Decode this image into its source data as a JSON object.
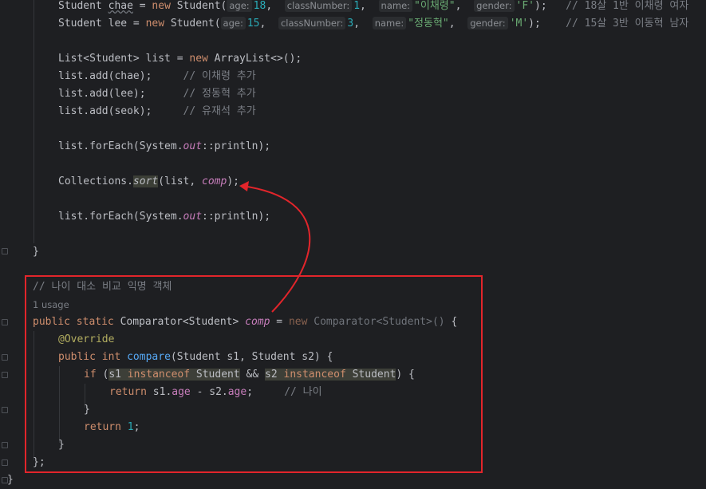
{
  "editor": {
    "language": "Java",
    "lines": {
      "l1": {
        "indent": "    ",
        "type": "Student",
        "var": "chae",
        "new_kw": "new",
        "ctor": "Student(",
        "hint_age": "age:",
        "age": "18",
        "hint_class": "classNumber:",
        "cls": "1",
        "hint_name": "name:",
        "name": "\"이채령\"",
        "hint_gender": "gender:",
        "gender": "'F'",
        "end": ");",
        "comment": "// 18살 1반 이채령 여자"
      },
      "l2": {
        "type": "Student",
        "var": "lee",
        "new_kw": "new",
        "ctor": "Student(",
        "hint_age": "age:",
        "age": "15",
        "hint_class": "classNumber:",
        "cls": "3",
        "hint_name": "name:",
        "name": "\"정동혁\"",
        "hint_gender": "gender:",
        "gender": "'M'",
        "end": ");",
        "comment": "// 15살 3반 이동혁 남자"
      },
      "l3": {
        "a": "List<Student> list = ",
        "new_kw": "new",
        "b": " ArrayList<>();"
      },
      "l4": {
        "code": "list.add(chae);",
        "comment": "// 이채령 추가"
      },
      "l5": {
        "code": "list.add(lee);",
        "comment": "// 정동혁 추가"
      },
      "l6": {
        "code": "list.add(seok);",
        "comment": "// 유재석 추가"
      },
      "l7": {
        "a": "list.forEach(System.",
        "out": "out",
        "b": "::println);"
      },
      "l8": {
        "a": "Collections.",
        "sort": "sort",
        "b": "(list, ",
        "comp": "comp",
        "c": ");"
      },
      "l9": {
        "a": "list.forEach(System.",
        "out": "out",
        "b": "::println);"
      },
      "l10": {
        "code": "}"
      },
      "l11": {
        "comment": "// 나이 대소 비교 익명 객체"
      },
      "usage": "1 usage",
      "l12": {
        "kw1": "public",
        "kw2": "static",
        "type": "Comparator<Student>",
        "var": "comp",
        "eq": " = ",
        "new_kw": "new",
        "grey": "Comparator<Student>()",
        "brace": " {"
      },
      "l13": {
        "ann": "@Override"
      },
      "l14": {
        "kw1": "public",
        "kw2": "int",
        "fn": "compare",
        "params": "(Student s1, Student s2) {"
      },
      "l15": {
        "kw": "if",
        "p1": " (",
        "s1": "s1",
        "inst1": "instanceof",
        "t1": "Student",
        "and": " && ",
        "s2": "s2",
        "inst2": "instanceof",
        "t2": "Student",
        "end": ") {"
      },
      "l16": {
        "kw": "return",
        "a": " s1.",
        "age1": "age",
        "b": " - s2.",
        "age2": "age",
        "c": ";",
        "comment": "// 나이"
      },
      "l17": {
        "code": "}"
      },
      "l18": {
        "kw": "return",
        "num": "1",
        "end": ";"
      },
      "l19": {
        "code": "}"
      },
      "l20": {
        "code": "};"
      },
      "l21": {
        "code": "}"
      }
    }
  }
}
